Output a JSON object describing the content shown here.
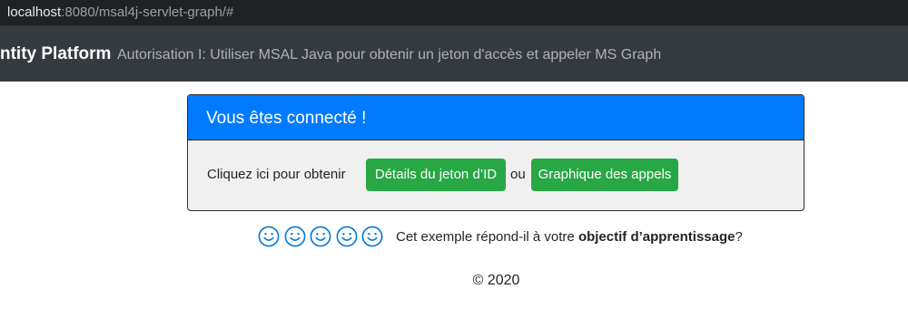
{
  "browser": {
    "url_host": "localhost",
    "url_rest": ":8080/msal4j-servlet-graph/#"
  },
  "navbar": {
    "brand": "ntity Platform",
    "link": "Autorisation I: Utiliser MSAL Java pour obtenir un jeton d'accès et appeler MS Graph"
  },
  "card": {
    "header": "Vous êtes connecté !",
    "prompt": "Cliquez ici pour obtenir",
    "id_token_button": "Détails du jeton d’ID",
    "or_text": "ou",
    "graph_button": "Graphique des appels"
  },
  "feedback": {
    "rating_icons": [
      "smiley-icon",
      "smiley-icon",
      "smiley-icon",
      "smiley-icon",
      "smiley-icon"
    ],
    "icon_color": "#0078d4",
    "question_prefix": "Cet exemple répond-il à votre ",
    "question_bold": "objectif d’apprentissage",
    "question_suffix": "?"
  },
  "footer": {
    "copyright": "© 2020"
  },
  "colors": {
    "navbar_bg": "#343a40",
    "card_header_bg": "#007bff",
    "button_bg": "#28a745",
    "card_body_bg": "#f0f0f0"
  }
}
